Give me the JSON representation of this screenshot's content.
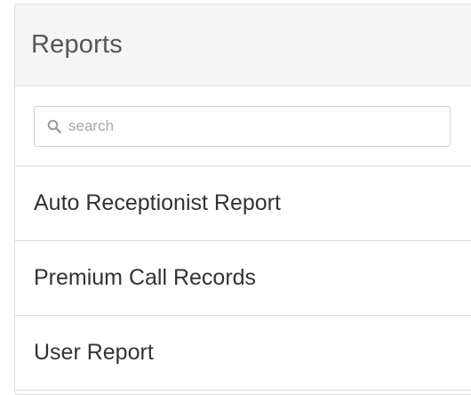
{
  "panel": {
    "title": "Reports"
  },
  "search": {
    "placeholder": "search",
    "value": ""
  },
  "reports": [
    {
      "label": "Auto Receptionist Report"
    },
    {
      "label": "Premium Call Records"
    },
    {
      "label": "User Report"
    }
  ]
}
